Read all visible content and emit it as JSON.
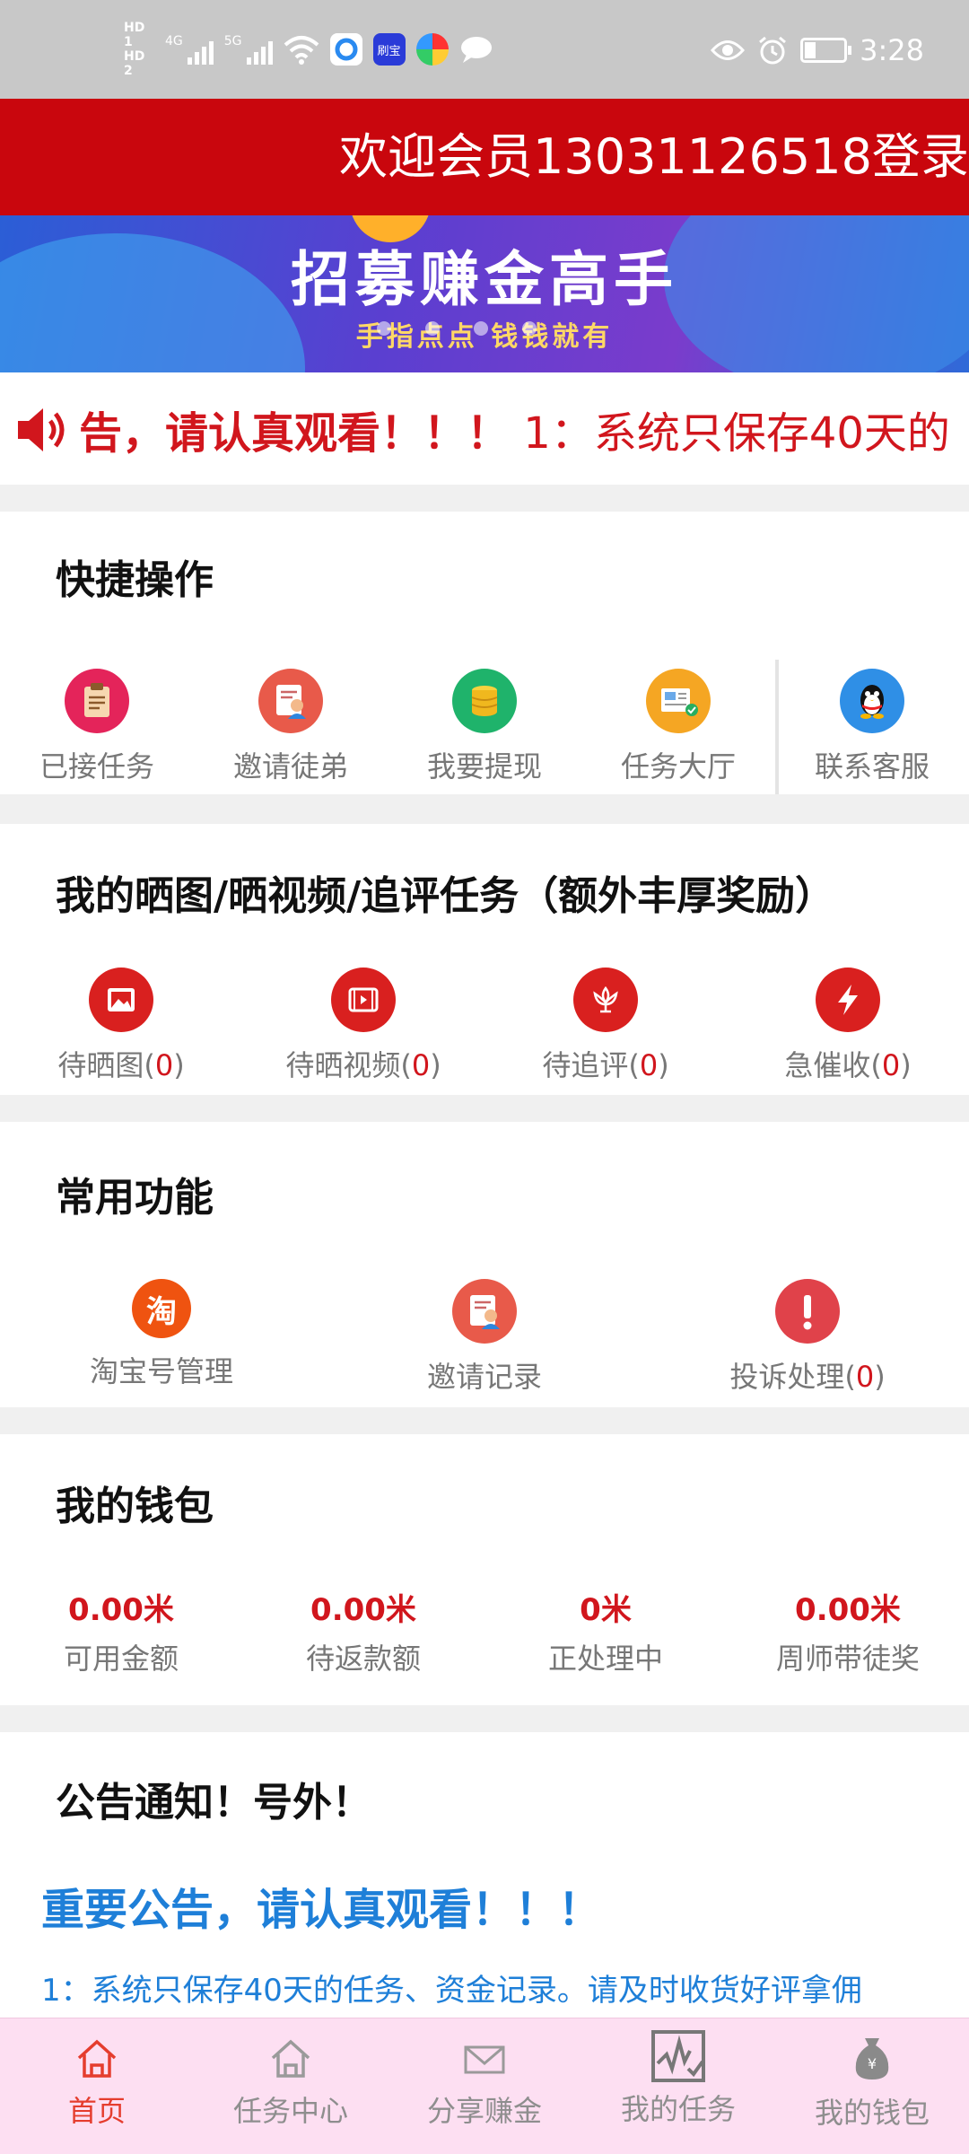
{
  "status_bar": {
    "time": "3:28",
    "hd1": "HD 1",
    "hd2": "HD 2",
    "net1": "4G",
    "net2": "5G",
    "wifi_label": "4",
    "app_label": "刷宝",
    "icons": [
      "signal-icon",
      "wifi-icon",
      "browser-icon",
      "shuabao-icon",
      "pinwheel-icon",
      "chat-icon",
      "eye-icon",
      "alarm-icon",
      "battery-icon"
    ]
  },
  "welcome": "欢迎会员13031126518登录!",
  "banner": {
    "title": "招募赚金高手",
    "subtitle": "手指点点 钱钱就有"
  },
  "marquee": {
    "text_bold": "告，请认真观看！！！",
    "text_rest": " 1：系统只保存40天的"
  },
  "quick_actions": {
    "title": "快捷操作",
    "items": [
      {
        "label": "已接任务",
        "icon": "clipboard-icon",
        "color": "#e4245a"
      },
      {
        "label": "邀请徒弟",
        "icon": "invite-icon",
        "color": "#e85a4a"
      },
      {
        "label": "我要提现",
        "icon": "coins-icon",
        "color": "#1fb36b"
      },
      {
        "label": "任务大厅",
        "icon": "newspaper-icon",
        "color": "#f5a623"
      },
      {
        "label": "联系客服",
        "icon": "qq-penguin-icon",
        "color": "#2f8fe6"
      }
    ]
  },
  "showcase_tasks": {
    "title": "我的晒图/晒视频/追评任务（额外丰厚奖励）",
    "items": [
      {
        "label": "待晒图",
        "count": "0",
        "icon": "image-icon"
      },
      {
        "label": "待晒视频",
        "count": "0",
        "icon": "video-icon"
      },
      {
        "label": "待追评",
        "count": "0",
        "icon": "flower-icon"
      },
      {
        "label": "急催收",
        "count": "0",
        "icon": "lightning-icon"
      }
    ]
  },
  "common_functions": {
    "title": "常用功能",
    "items": [
      {
        "label": "淘宝号管理",
        "icon": "taobao-icon",
        "glyph": "淘",
        "color": "#ef5310"
      },
      {
        "label": "邀请记录",
        "icon": "invite-record-icon",
        "color": "#e85a4a"
      },
      {
        "label": "投诉处理",
        "count": "0",
        "icon": "alert-icon",
        "color": "#e0424a"
      }
    ]
  },
  "wallet": {
    "title": "我的钱包",
    "items": [
      {
        "value": "0.00米",
        "label": "可用金额"
      },
      {
        "value": "0.00米",
        "label": "待返款额"
      },
      {
        "value": "0米",
        "label": "正处理中"
      },
      {
        "value": "0.00米",
        "label": "周师带徒奖"
      }
    ]
  },
  "notice": {
    "title": "公告通知！号外！",
    "headline": "重要公告，请认真观看！！！",
    "line1": "1：系统只保存40天的任务、资金记录。请及时收货好评拿佣"
  },
  "bottom_nav": [
    {
      "label": "首页",
      "icon": "home-icon",
      "active": true
    },
    {
      "label": "任务中心",
      "icon": "task-center-icon",
      "active": false
    },
    {
      "label": "分享赚金",
      "icon": "envelope-icon",
      "active": false
    },
    {
      "label": "我的任务",
      "icon": "chart-task-icon",
      "active": false
    },
    {
      "label": "我的钱包",
      "icon": "money-bag-icon",
      "active": false
    }
  ],
  "colors": {
    "brand_red": "#c9060d",
    "accent_red": "#d1161d",
    "notice_blue": "#1e7fd8",
    "nav_bg": "#fddff2"
  }
}
